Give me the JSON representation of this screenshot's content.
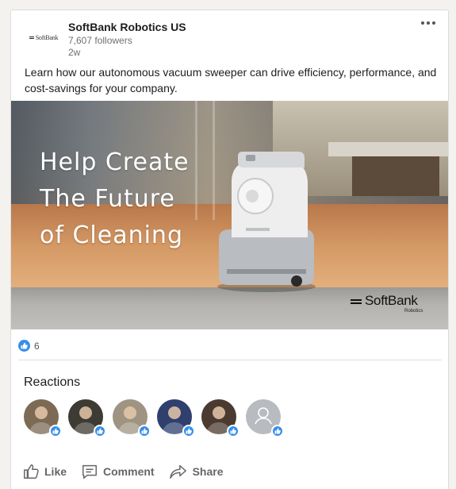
{
  "post": {
    "company": "SoftBank Robotics US",
    "followers": "7,607 followers",
    "age": "2w",
    "logo_text": "SoftBank",
    "text": "Learn how our autonomous vacuum sweeper can drive efficiency, performance, and cost-savings for your company."
  },
  "banner": {
    "headline_lines": [
      "Help Create",
      "The Future",
      "of Cleaning"
    ],
    "brand": "SoftBank",
    "brand_sub": "Robotics"
  },
  "social": {
    "reaction_count": "6",
    "reactions_title": "Reactions",
    "avatars": [
      {
        "color": "#7d6a55",
        "icon": "person-photo"
      },
      {
        "color": "#3e3a34",
        "icon": "person-photo"
      },
      {
        "color": "#9f9482",
        "icon": "person-photo"
      },
      {
        "color": "#2f3f6e",
        "icon": "person-photo"
      },
      {
        "color": "#4a3a30",
        "icon": "person-photo"
      },
      {
        "color": "#b8bcc0",
        "icon": "person-placeholder-icon"
      }
    ]
  },
  "actions": {
    "like": "Like",
    "comment": "Comment",
    "share": "Share"
  },
  "colors": {
    "accent": "#378fe9",
    "muted_text": "#707070"
  }
}
